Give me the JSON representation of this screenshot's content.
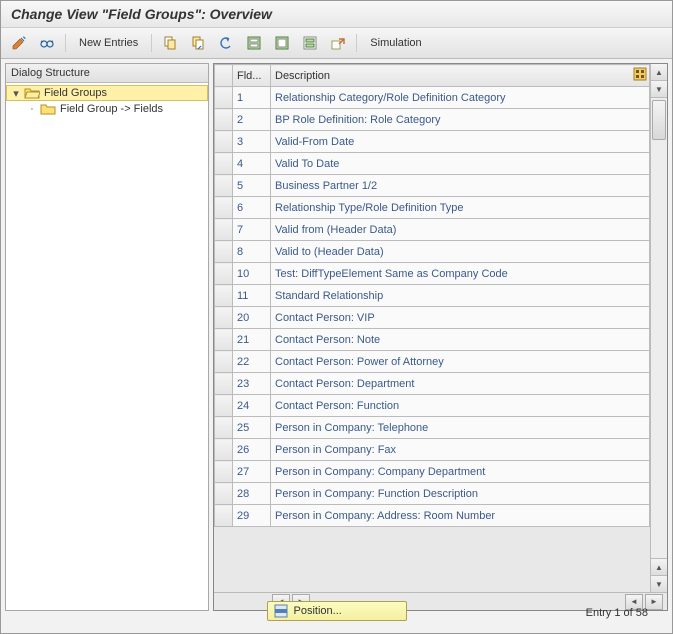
{
  "title": "Change View \"Field Groups\": Overview",
  "toolbar": {
    "new_entries_label": "New Entries",
    "simulation_label": "Simulation"
  },
  "tree": {
    "header": "Dialog Structure",
    "items": [
      {
        "label": "Field Groups",
        "open": true,
        "level": 0,
        "selected": true,
        "expander": "▾"
      },
      {
        "label": "Field Group -> Fields",
        "open": false,
        "level": 1,
        "selected": false,
        "expander": "·"
      }
    ]
  },
  "table": {
    "columns": {
      "fld": "Fld...",
      "desc": "Description"
    },
    "rows": [
      {
        "fld": "1",
        "desc": "Relationship Category/Role Definition Category"
      },
      {
        "fld": "2",
        "desc": "BP Role Definition: Role Category"
      },
      {
        "fld": "3",
        "desc": "Valid-From Date"
      },
      {
        "fld": "4",
        "desc": "Valid To Date"
      },
      {
        "fld": "5",
        "desc": "Business Partner 1/2"
      },
      {
        "fld": "6",
        "desc": "Relationship Type/Role Definition Type"
      },
      {
        "fld": "7",
        "desc": "Valid from (Header Data)"
      },
      {
        "fld": "8",
        "desc": "Valid to (Header Data)"
      },
      {
        "fld": "10",
        "desc": "Test: DiffTypeElement Same as Company Code"
      },
      {
        "fld": "11",
        "desc": "Standard Relationship"
      },
      {
        "fld": "20",
        "desc": "Contact Person: VIP"
      },
      {
        "fld": "21",
        "desc": "Contact Person: Note"
      },
      {
        "fld": "22",
        "desc": "Contact Person: Power of Attorney"
      },
      {
        "fld": "23",
        "desc": "Contact Person: Department"
      },
      {
        "fld": "24",
        "desc": "Contact Person: Function"
      },
      {
        "fld": "25",
        "desc": "Person in Company: Telephone"
      },
      {
        "fld": "26",
        "desc": "Person in Company: Fax"
      },
      {
        "fld": "27",
        "desc": "Person in Company: Company Department"
      },
      {
        "fld": "28",
        "desc": "Person in Company: Function Description"
      },
      {
        "fld": "29",
        "desc": "Person in Company: Address: Room Number"
      }
    ]
  },
  "footer": {
    "position_label": "Position...",
    "entry_text": "Entry 1 of 58"
  },
  "icons": {
    "toggle": "toggle-icon",
    "glasses": "display-icon",
    "copy": "copy-icon",
    "paste": "paste-icon",
    "undo": "undo-icon",
    "select_all": "select-all-icon",
    "save": "save-icon",
    "deselect": "deselect-icon",
    "export": "export-icon",
    "table_settings": "table-settings-icon",
    "position": "position-icon"
  }
}
